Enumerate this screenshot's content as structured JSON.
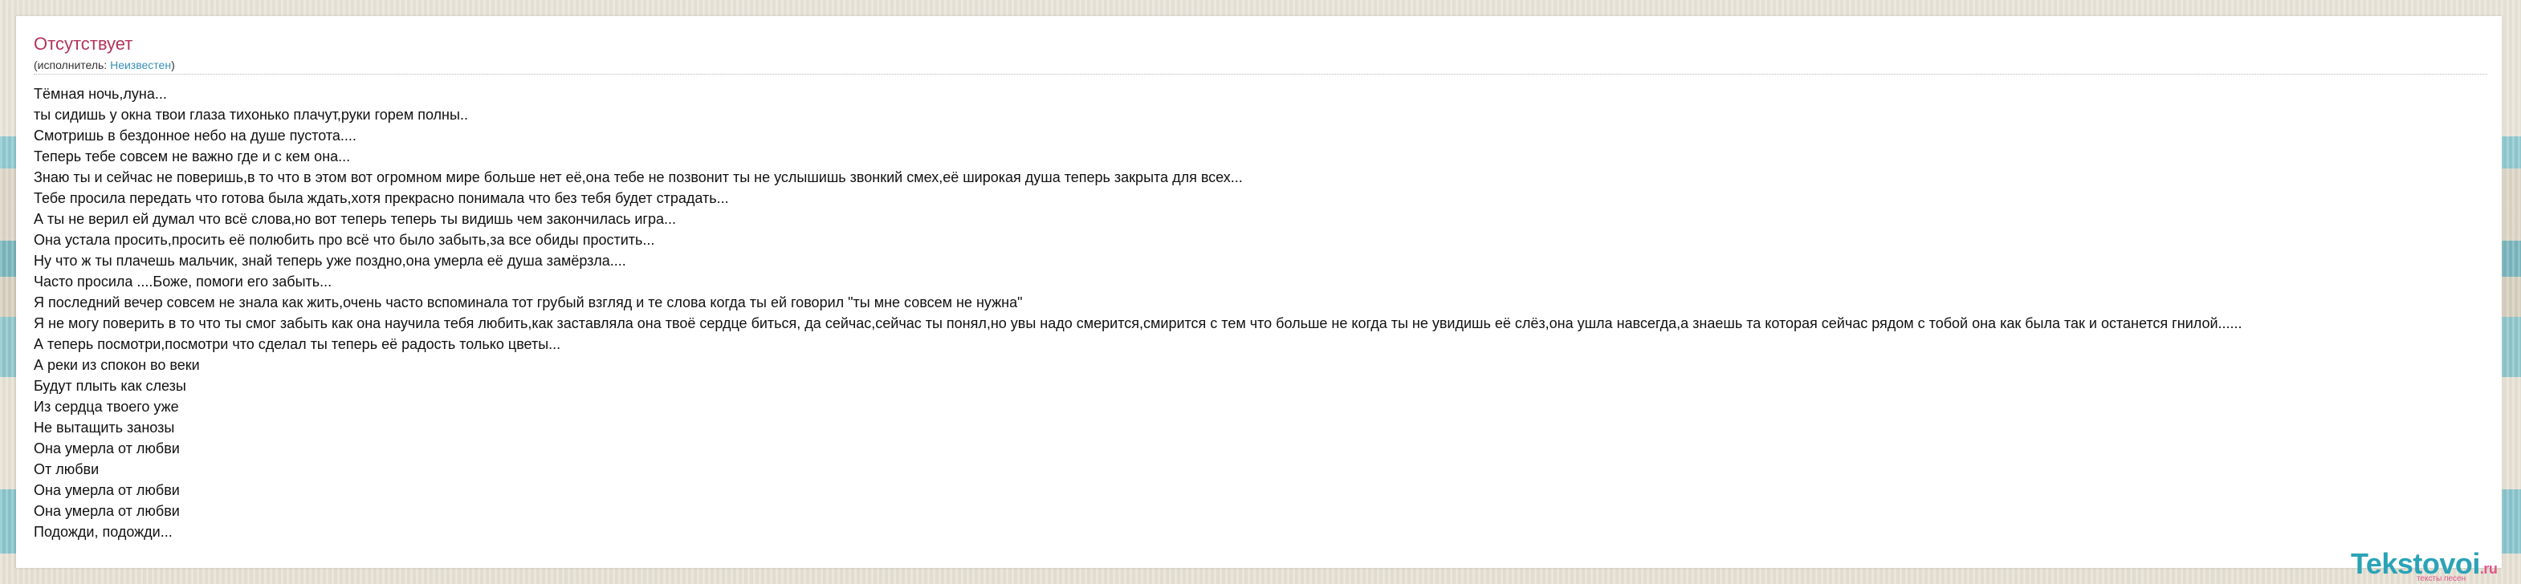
{
  "song": {
    "title": "Отсутствует",
    "performer_prefix": "(исполнитель: ",
    "performer_name": "Неизвестен",
    "performer_suffix": ")"
  },
  "lyrics": [
    "Тёмная ночь,луна...",
    "ты сидишь у окна твои глаза тихонько плачут,руки горем полны..",
    "Смотришь в бездонное небо на душе пустота....",
    "Теперь тебе совсем не важно где и с кем она...",
    "Знаю ты и сейчас не поверишь,в то что в этом вот огромном мире больше нет её,она тебе не позвонит ты не услышишь звонкий смех,её широкая душа теперь закрыта для всех...",
    "Тебе просила передать что готова была ждать,хотя прекрасно понимала что без тебя будет страдать...",
    "А ты не верил ей думал что всё слова,но вот теперь теперь ты видишь чем закончилась игра...",
    "Она устала просить,просить её полюбить про всё что было забыть,за все обиды простить...",
    "Ну что ж ты плачешь мальчик, знай теперь уже поздно,она умерла её душа замёрзла....",
    "Часто просила ....Боже, помоги его забыть...",
    "Я последний вечер совсем не знала как жить,очень часто вспоминала тот грубый взгляд и те слова когда ты ей говорил \"ты мне совсем не нужна\"",
    "Я не могу поверить в то что ты смог забыть как она научила тебя любить,как заставляла она твоё сердце биться, да сейчас,сейчас ты понял,но увы надо смерится,смирится с тем что больше не когда ты не увидишь её слёз,она ушла навсегда,а знаешь та которая сейчас рядом с тобой она как была так и останется гнилой......",
    "А теперь посмотри,посмотри что сделал ты теперь её радость только цветы...",
    "А реки из спокон во веки",
    "Будут плыть как слезы",
    "Из сердца твоего уже",
    "Не вытащить занозы",
    "Она умерла от любви",
    "От любви",
    "Она умерла от любви",
    "Она умерла от любви",
    "Подожди, подожди..."
  ],
  "logo": {
    "name": "Tekstovoi",
    "domain": ".ru",
    "tagline": "тексты песен"
  },
  "colors": {
    "title": "#b4345a",
    "performer_link": "#3a8fb8",
    "logo_main": "#2aa3b7",
    "logo_accent": "#e0558b"
  }
}
